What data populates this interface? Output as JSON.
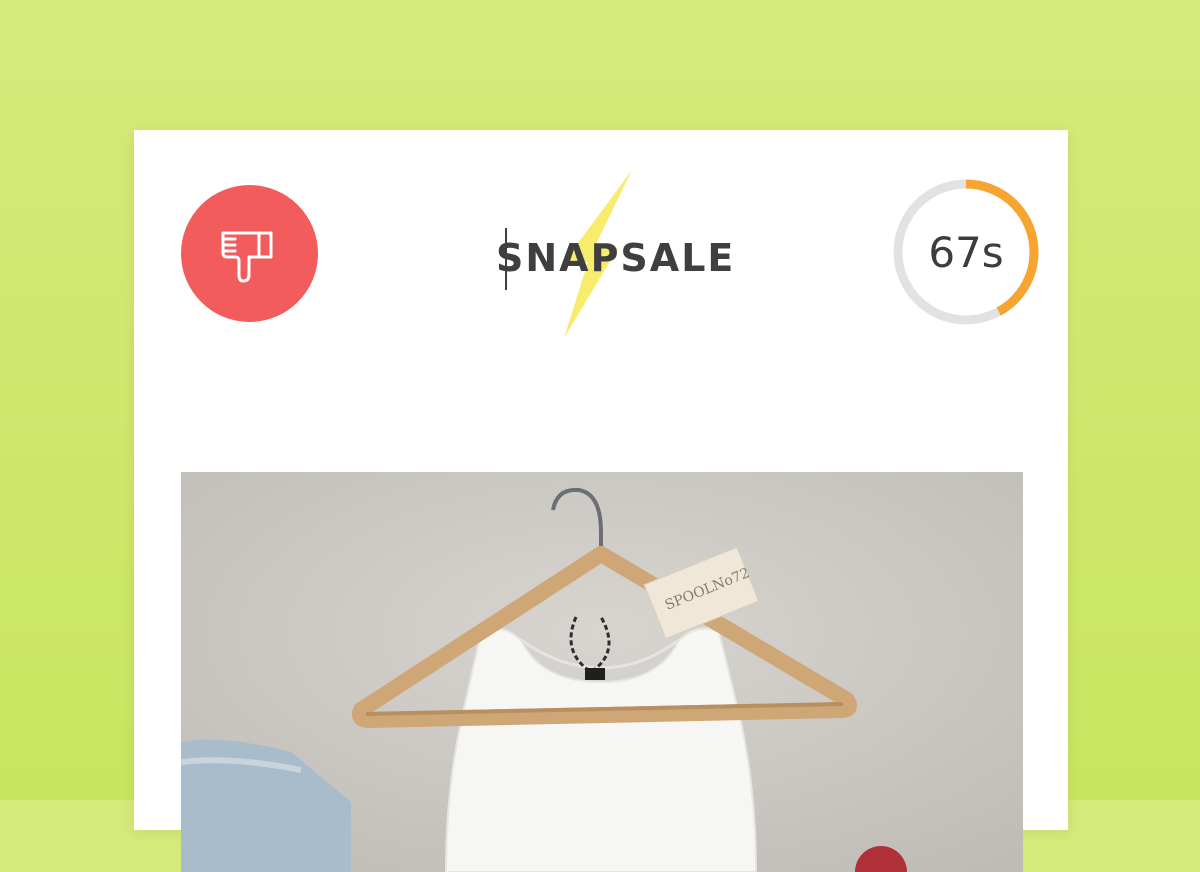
{
  "app": {
    "brand": "SNAPSALE"
  },
  "colors": {
    "background": "#cde66a",
    "dislike": "#f25c5c",
    "timer_track": "#e2e2e2",
    "timer_progress": "#f7a531",
    "bolt": "#f8ec6c",
    "text": "#3f3f3f"
  },
  "actions": {
    "dislike_icon": "thumbs-down-icon"
  },
  "timer": {
    "label": "67s",
    "progress_fraction": 0.42
  },
  "product": {
    "image": "white-tank-top-on-wooden-hanger",
    "tag_text": "SPOOLNo72"
  }
}
